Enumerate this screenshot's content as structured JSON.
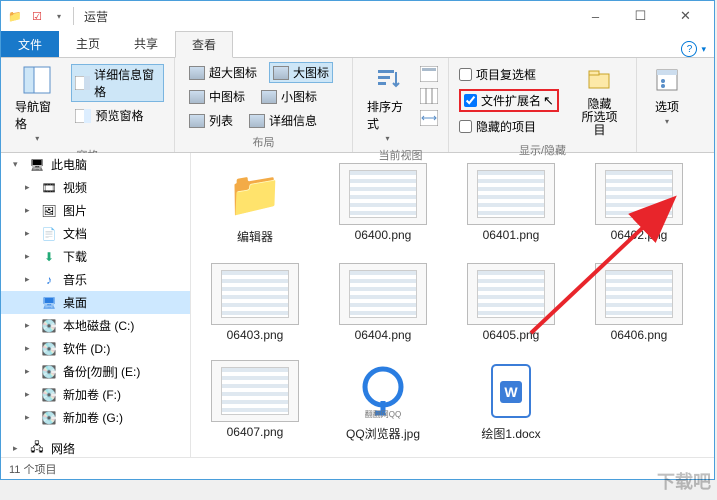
{
  "titlebar": {
    "title": "运营"
  },
  "win_controls": {
    "min": "–",
    "max": "☐",
    "close": "✕"
  },
  "tabs": {
    "file": "文件",
    "home": "主页",
    "share": "共享",
    "view": "查看"
  },
  "ribbon": {
    "panes": {
      "group_label": "窗格",
      "nav_pane": "导航窗格",
      "detail_pane": "详细信息窗格",
      "preview_pane": "预览窗格"
    },
    "layout": {
      "group_label": "布局",
      "extralarge": "超大图标",
      "large": "大图标",
      "medium": "中图标",
      "small": "小图标",
      "list": "列表",
      "details": "详细信息"
    },
    "current_view": {
      "group_label": "当前视图",
      "sort_by": "排序方式"
    },
    "show_hide": {
      "group_label": "显示/隐藏",
      "item_checkboxes": "项目复选框",
      "file_ext": "文件扩展名",
      "hidden_items": "隐藏的项目",
      "hide_selected": "隐藏\n所选项目"
    },
    "options": {
      "label": "选项"
    }
  },
  "nav": {
    "this_pc": "此电脑",
    "videos": "视频",
    "pictures": "图片",
    "documents": "文档",
    "downloads": "下载",
    "music": "音乐",
    "desktop": "桌面",
    "drive_c": "本地磁盘 (C:)",
    "drive_d": "软件 (D:)",
    "drive_e": "备份[勿删] (E:)",
    "drive_f": "新加卷 (F:)",
    "drive_g": "新加卷 (G:)",
    "network": "网络"
  },
  "files": [
    {
      "name": "编辑器",
      "type": "folder"
    },
    {
      "name": "06400.png",
      "type": "image"
    },
    {
      "name": "06401.png",
      "type": "image"
    },
    {
      "name": "06402.png",
      "type": "image"
    },
    {
      "name": "06403.png",
      "type": "image"
    },
    {
      "name": "06404.png",
      "type": "image"
    },
    {
      "name": "06405.png",
      "type": "image"
    },
    {
      "name": "06406.png",
      "type": "image"
    },
    {
      "name": "06407.png",
      "type": "image"
    },
    {
      "name": "QQ浏览器.jpg",
      "type": "qq"
    },
    {
      "name": "绘图1.docx",
      "type": "doc"
    }
  ],
  "status": {
    "item_count": "11 个项目"
  },
  "watermark": "下载吧"
}
